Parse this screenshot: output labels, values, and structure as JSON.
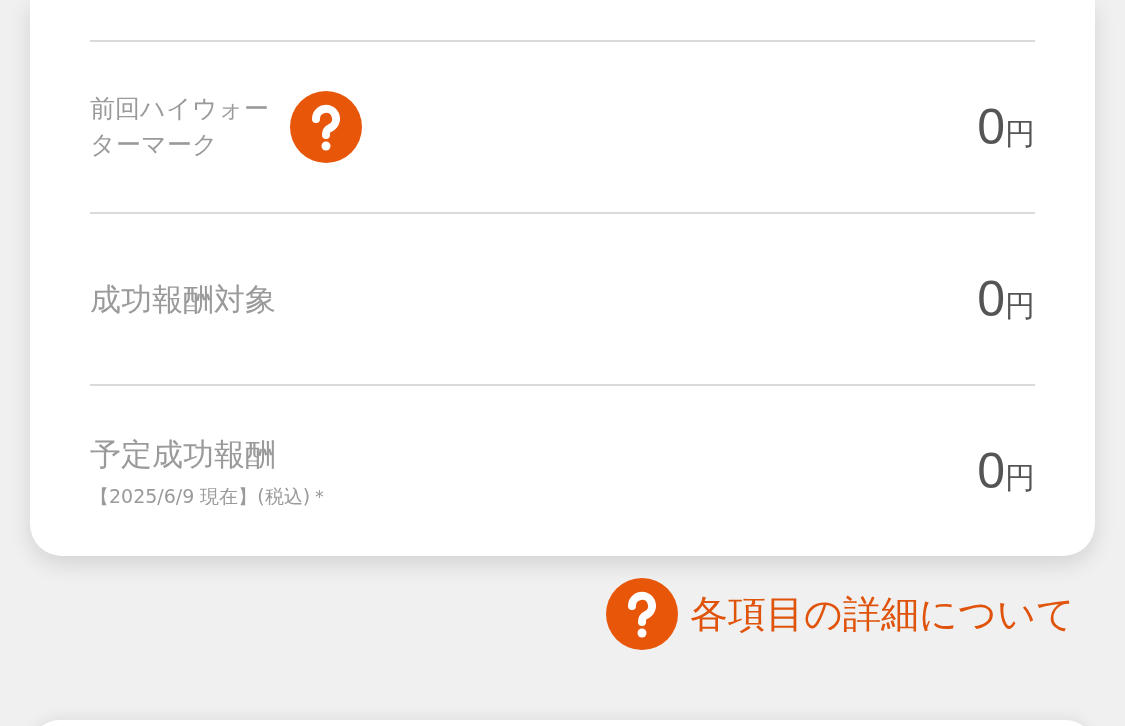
{
  "rows": [
    {
      "label": "前回ハイウォーターマーク",
      "help": true,
      "amount": "0",
      "unit": "円"
    },
    {
      "label": "成功報酬対象",
      "help": false,
      "amount": "0",
      "unit": "円"
    },
    {
      "label": "予定成功報酬",
      "note": "【2025/6/9 現在】(税込)＊",
      "help": false,
      "amount": "0",
      "unit": "円"
    }
  ],
  "details_link": {
    "label": "各項目の詳細について"
  }
}
